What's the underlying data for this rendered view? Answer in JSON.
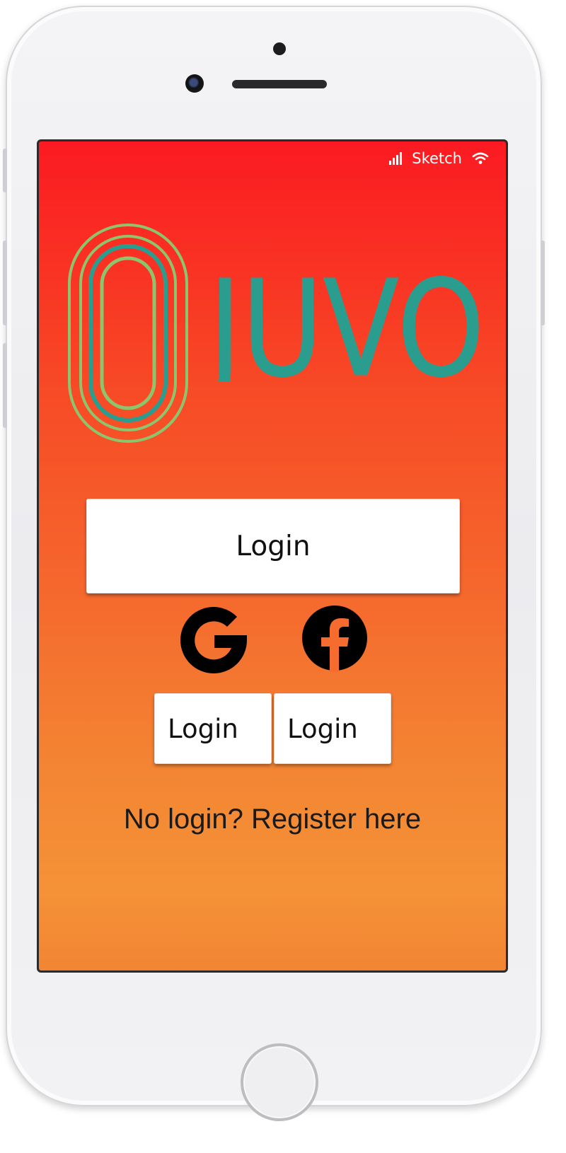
{
  "status_bar": {
    "carrier": "Sketch",
    "signal_icon": "signal-bars-icon",
    "wifi_icon": "wifi-icon"
  },
  "brand": {
    "name": "JUVO",
    "logo_icon": "running-track-icon",
    "text_color": "#2a9d8f",
    "mark_colors": [
      "#8cc56b",
      "#2a9d8f"
    ]
  },
  "login": {
    "main_label": "Login",
    "google_label": "Login",
    "facebook_label": "Login",
    "google_icon": "google-icon",
    "facebook_icon": "facebook-icon"
  },
  "register": {
    "text": "No login? Register here"
  },
  "device": {
    "home_button_icon": "home-button",
    "camera_icon": "camera-icon"
  },
  "theme": {
    "gradient_top": "#fb1a21",
    "gradient_bottom": "#f59237"
  }
}
